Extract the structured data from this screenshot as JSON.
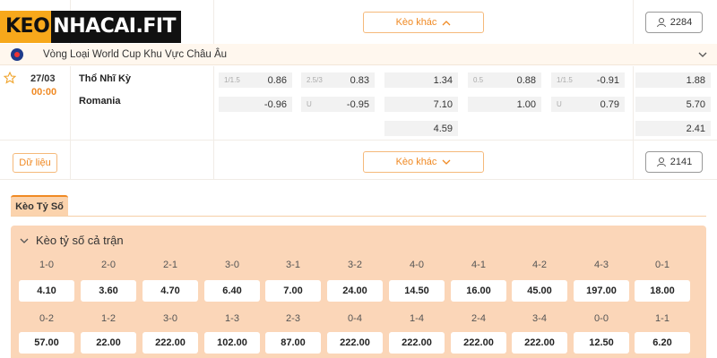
{
  "logo": {
    "part1": "KEO",
    "part2": "NHACAI.FIT"
  },
  "top_row": {
    "more_odds_label": "Kèo khác",
    "count": "2284"
  },
  "league": {
    "name": "Vòng Loại World Cup Khu Vực Châu Âu"
  },
  "match": {
    "date": "27/03",
    "time": "00:00",
    "home": "Thổ Nhĩ Kỳ",
    "away": "Romania",
    "odds": {
      "c1": [
        {
          "hc": "1/1.5",
          "v": "0.86"
        },
        {
          "hc": "",
          "v": "-0.96"
        }
      ],
      "c2": [
        {
          "hc": "2.5/3",
          "v": "0.83"
        },
        {
          "hc": "U",
          "v": "-0.95"
        }
      ],
      "c3": [
        {
          "v": "1.34"
        },
        {
          "v": "7.10"
        },
        {
          "v": "4.59"
        }
      ],
      "c4": [
        {
          "hc": "0.5",
          "v": "0.88"
        },
        {
          "hc": "",
          "v": "1.00"
        }
      ],
      "c5": [
        {
          "hc": "1/1.5",
          "v": "-0.91"
        },
        {
          "hc": "U",
          "v": "0.79"
        }
      ],
      "c6": [
        {
          "v": "1.88"
        },
        {
          "v": "5.70"
        },
        {
          "v": "2.41"
        }
      ]
    },
    "data_label": "Dữ liệu",
    "more_odds_label": "Kèo khác",
    "count": "2141"
  },
  "tab": {
    "label": "Kèo Tỷ Số"
  },
  "panel": {
    "title": "Kèo tỷ số cả trận",
    "row1": [
      {
        "s": "1-0",
        "o": "4.10"
      },
      {
        "s": "2-0",
        "o": "3.60"
      },
      {
        "s": "2-1",
        "o": "4.70"
      },
      {
        "s": "3-0",
        "o": "6.40"
      },
      {
        "s": "3-1",
        "o": "7.00"
      },
      {
        "s": "3-2",
        "o": "24.00"
      },
      {
        "s": "4-0",
        "o": "14.50"
      },
      {
        "s": "4-1",
        "o": "16.00"
      },
      {
        "s": "4-2",
        "o": "45.00"
      },
      {
        "s": "4-3",
        "o": "197.00"
      },
      {
        "s": "0-1",
        "o": "18.00"
      }
    ],
    "row2": [
      {
        "s": "0-2",
        "o": "57.00"
      },
      {
        "s": "1-2",
        "o": "22.00"
      },
      {
        "s": "3-0",
        "o": "222.00"
      },
      {
        "s": "1-3",
        "o": "102.00"
      },
      {
        "s": "2-3",
        "o": "87.00"
      },
      {
        "s": "0-4",
        "o": "222.00"
      },
      {
        "s": "1-4",
        "o": "222.00"
      },
      {
        "s": "2-4",
        "o": "222.00"
      },
      {
        "s": "3-4",
        "o": "222.00"
      },
      {
        "s": "0-0",
        "o": "12.50"
      },
      {
        "s": "1-1",
        "o": "6.20"
      }
    ]
  },
  "colors": {
    "accent": "#f08a24",
    "panel": "#fbd6b8",
    "logo_yellow": "#f7a81b"
  },
  "icons": {
    "user": "user-icon",
    "chevron_up": "chevron-up-icon",
    "chevron_down": "chevron-down-icon",
    "star": "star-icon",
    "flag": "league-flag-icon"
  }
}
